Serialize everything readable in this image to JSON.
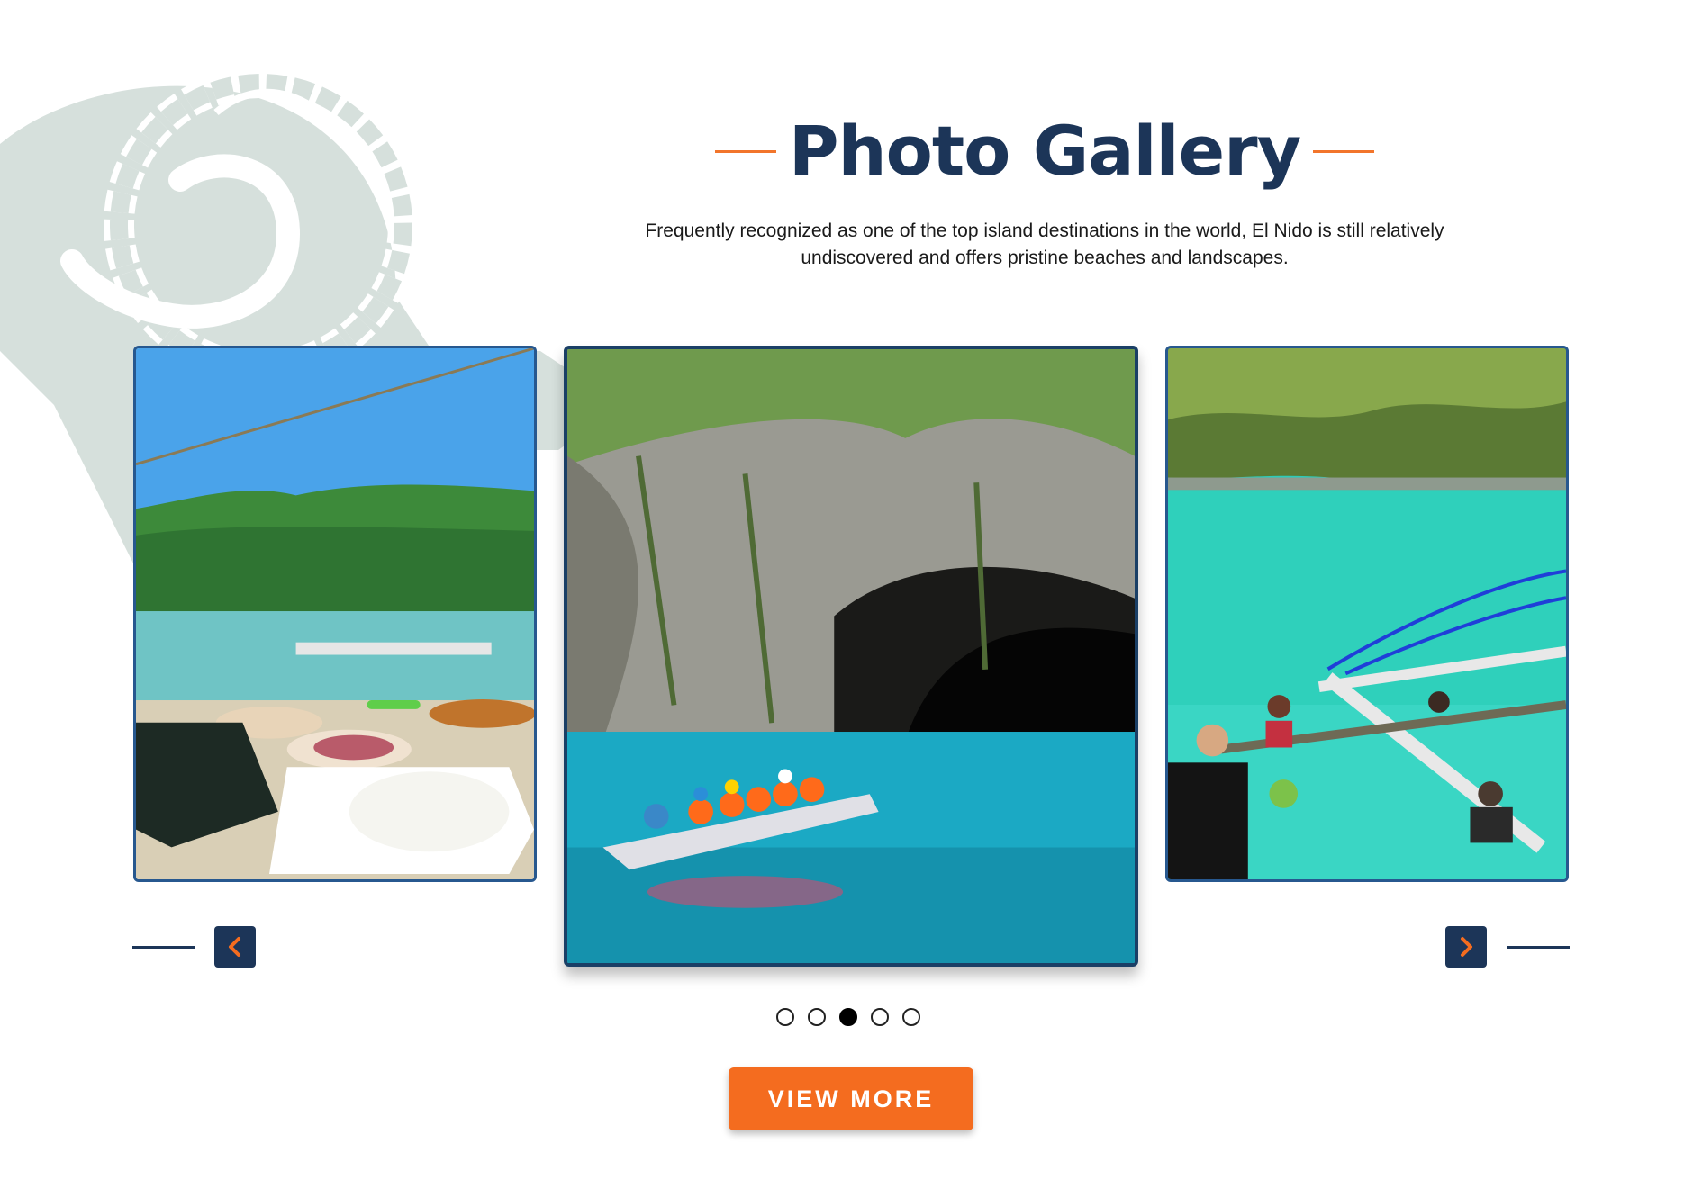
{
  "header": {
    "title": "Photo Gallery",
    "subtitle": "Frequently recognized as one of the top island destinations in the world, El Nido is still relatively undiscovered and offers pristine beaches and landscapes."
  },
  "gallery": {
    "slides_count": 5,
    "active_slide_index": 2,
    "cta_label": "VIEW MORE"
  },
  "icons": {
    "decoration": "ram-horn-icon",
    "prev": "chevron-left-icon",
    "next": "chevron-right-icon"
  },
  "colors": {
    "brand_navy": "#1c3558",
    "accent_orange": "#f46c1f",
    "decor_green": "#d6e0dc"
  }
}
